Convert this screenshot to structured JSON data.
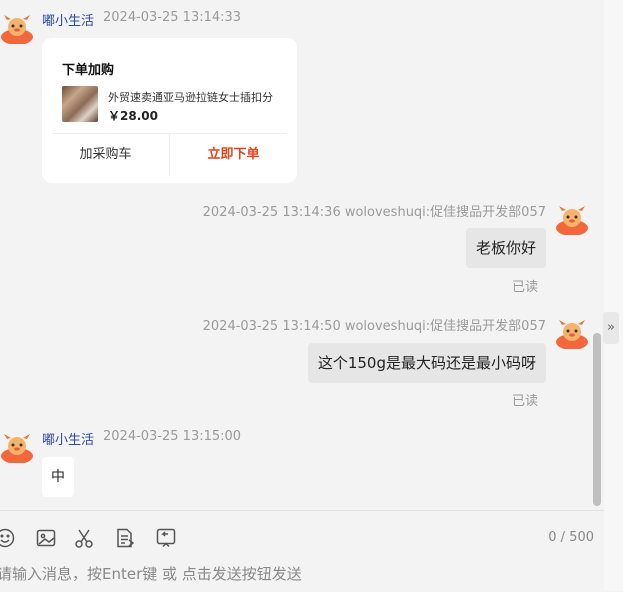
{
  "messages": {
    "m1": {
      "sender": "嘟小生活",
      "time": "2024-03-25 13:14:33"
    },
    "card": {
      "title": "下单加购",
      "product": "外贸速卖通亚马逊拉链女士插扣分",
      "price": "￥28.00",
      "add_cart": "加采购车",
      "buy_now": "立即下单"
    },
    "m2": {
      "meta": "2024-03-25 13:14:36   woloveshuqi:促佳搜品开发部057",
      "text": "老板你好",
      "status": "已读"
    },
    "m3": {
      "meta": "2024-03-25 13:14:50   woloveshuqi:促佳搜品开发部057",
      "text": "这个150g是最大码还是最小码呀",
      "status": "已读"
    },
    "m4": {
      "sender": "嘟小生活",
      "time": "2024-03-25 13:15:00",
      "text": "中"
    }
  },
  "composer": {
    "placeholder": "请输入消息，按Enter键 或 点击发送按钮发送",
    "char_count": "0 / 500",
    "tools": [
      "emoji-icon",
      "image-icon",
      "scissors-icon",
      "document-icon",
      "recall-icon"
    ]
  },
  "colors": {
    "accent_red": "#e2441b",
    "name_blue": "#2b4aa3",
    "card_bg": "#ffffff"
  }
}
